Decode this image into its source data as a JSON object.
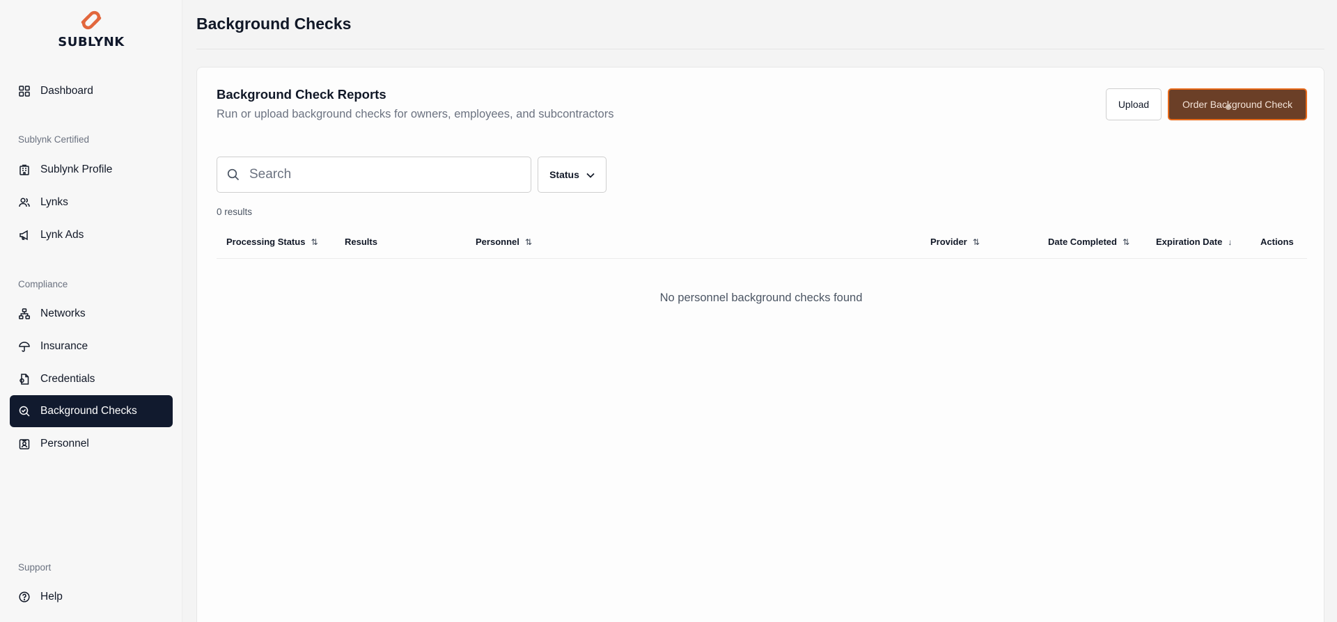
{
  "brand": {
    "name": "SUBLYNK",
    "colors": {
      "accent": "#e2673d",
      "sidebar_active_bg": "#111a2e",
      "order_button_bg": "#6b3f27",
      "order_button_border": "#e86a1a"
    }
  },
  "sidebar": {
    "dashboard": {
      "label": "Dashboard",
      "icon": "grid-icon"
    },
    "sections": [
      {
        "label": "Sublynk Certified"
      },
      {
        "label": "Compliance"
      },
      {
        "label": "Support"
      }
    ],
    "items": [
      {
        "label": "Sublynk Profile",
        "icon": "building-icon"
      },
      {
        "label": "Lynks",
        "icon": "users-icon"
      },
      {
        "label": "Lynk Ads",
        "icon": "megaphone-icon"
      },
      {
        "label": "Networks",
        "icon": "network-icon"
      },
      {
        "label": "Insurance",
        "icon": "umbrella-icon"
      },
      {
        "label": "Credentials",
        "icon": "document-badge-icon"
      },
      {
        "label": "Background Checks",
        "icon": "search-check-icon",
        "active": true
      },
      {
        "label": "Personnel",
        "icon": "id-badge-icon"
      },
      {
        "label": "Help",
        "icon": "help-circle-icon"
      }
    ]
  },
  "header": {
    "title": "Background Checks"
  },
  "card": {
    "title": "Background Check Reports",
    "subtitle": "Run or upload background checks for owners, employees, and subcontractors",
    "upload_label": "Upload",
    "order_label": "Order Background Check",
    "search_placeholder": "Search",
    "status_filter_label": "Status",
    "results_count": "0 results",
    "columns": [
      {
        "label": "Processing Status",
        "sort": "⇅"
      },
      {
        "label": "Results",
        "sort": ""
      },
      {
        "label": "Personnel",
        "sort": "⇅"
      },
      {
        "label": "Provider",
        "sort": "⇅"
      },
      {
        "label": "Date Completed",
        "sort": "⇅"
      },
      {
        "label": "Expiration Date",
        "sort": "↓"
      },
      {
        "label": "Actions",
        "sort": ""
      }
    ],
    "empty_message": "No personnel background checks found"
  }
}
